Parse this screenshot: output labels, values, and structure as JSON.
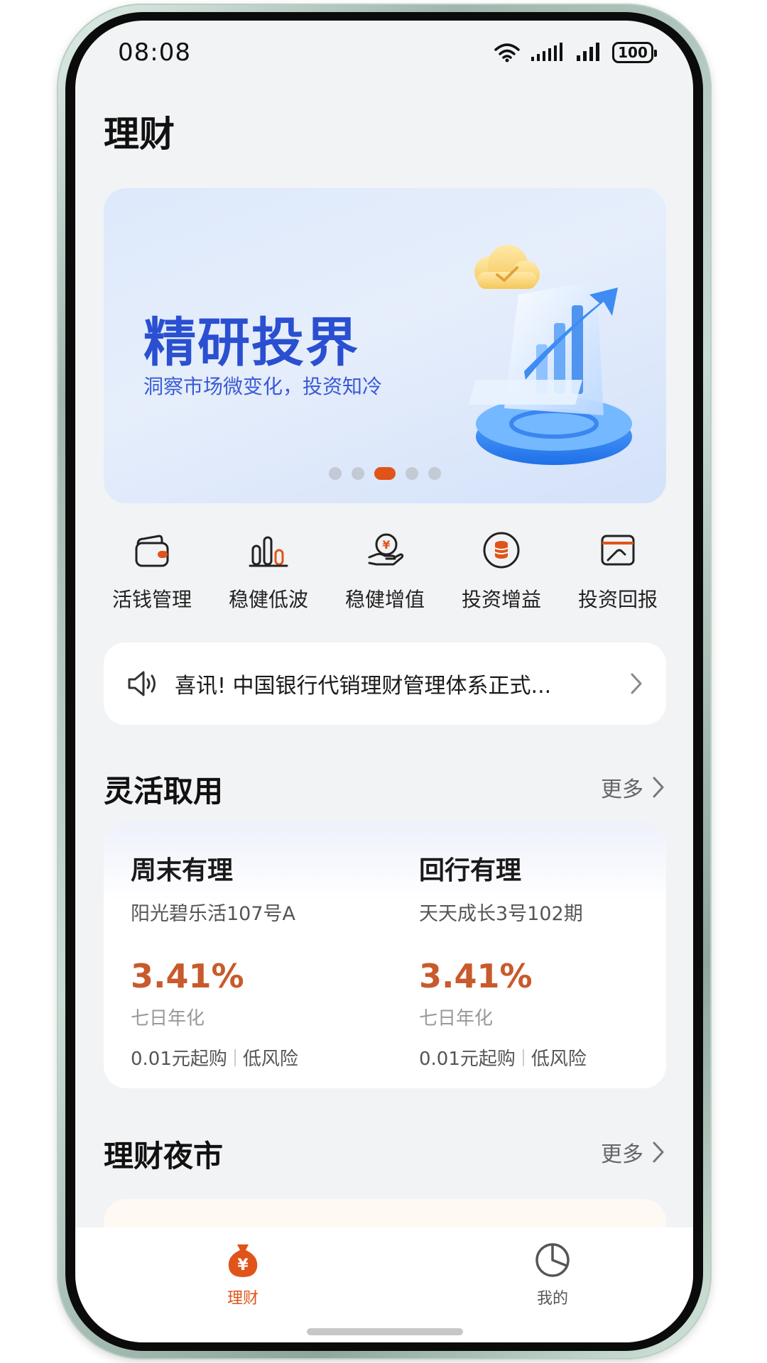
{
  "status_bar": {
    "time": "08:08",
    "battery": "100",
    "icons": [
      "wifi-icon",
      "signal-icon",
      "signal-icon",
      "battery-icon"
    ]
  },
  "page": {
    "title": "理财"
  },
  "banner": {
    "title": "精研投界",
    "subtitle": "洞察市场微变化，投资知冷",
    "slide_count": 5,
    "active_slide": 3
  },
  "quick_actions": [
    {
      "label": "活钱管理",
      "icon": "wallet-icon"
    },
    {
      "label": "稳健低波",
      "icon": "bar-chart-icon"
    },
    {
      "label": "稳健增值",
      "icon": "hand-coin-icon"
    },
    {
      "label": "投资增益",
      "icon": "coin-stack-icon"
    },
    {
      "label": "投资回报",
      "icon": "card-hand-icon"
    }
  ],
  "notice": {
    "icon": "speaker-icon",
    "text": "喜讯!   中国银行代销理财管理体系正式..."
  },
  "section_flexible": {
    "title": "灵活取用",
    "more_label": "更多",
    "products": [
      {
        "name": "周末有理",
        "subtitle": "阳光碧乐活107号A",
        "rate": "3.41%",
        "rate_label": "七日年化",
        "min_purchase": "0.01元起购",
        "risk": "低风险"
      },
      {
        "name": "回行有理",
        "subtitle": "天天成长3号102期",
        "rate": "3.41%",
        "rate_label": "七日年化",
        "min_purchase": "0.01元起购",
        "risk": "低风险"
      }
    ]
  },
  "section_night_market": {
    "title": "理财夜市",
    "more_label": "更多"
  },
  "tabbar": {
    "tabs": [
      {
        "label": "理财",
        "icon": "money-bag-icon",
        "active": true
      },
      {
        "label": "我的",
        "icon": "pie-chart-icon",
        "active": false
      }
    ],
    "active_color": "#e0541a",
    "inactive_color": "#555555"
  }
}
